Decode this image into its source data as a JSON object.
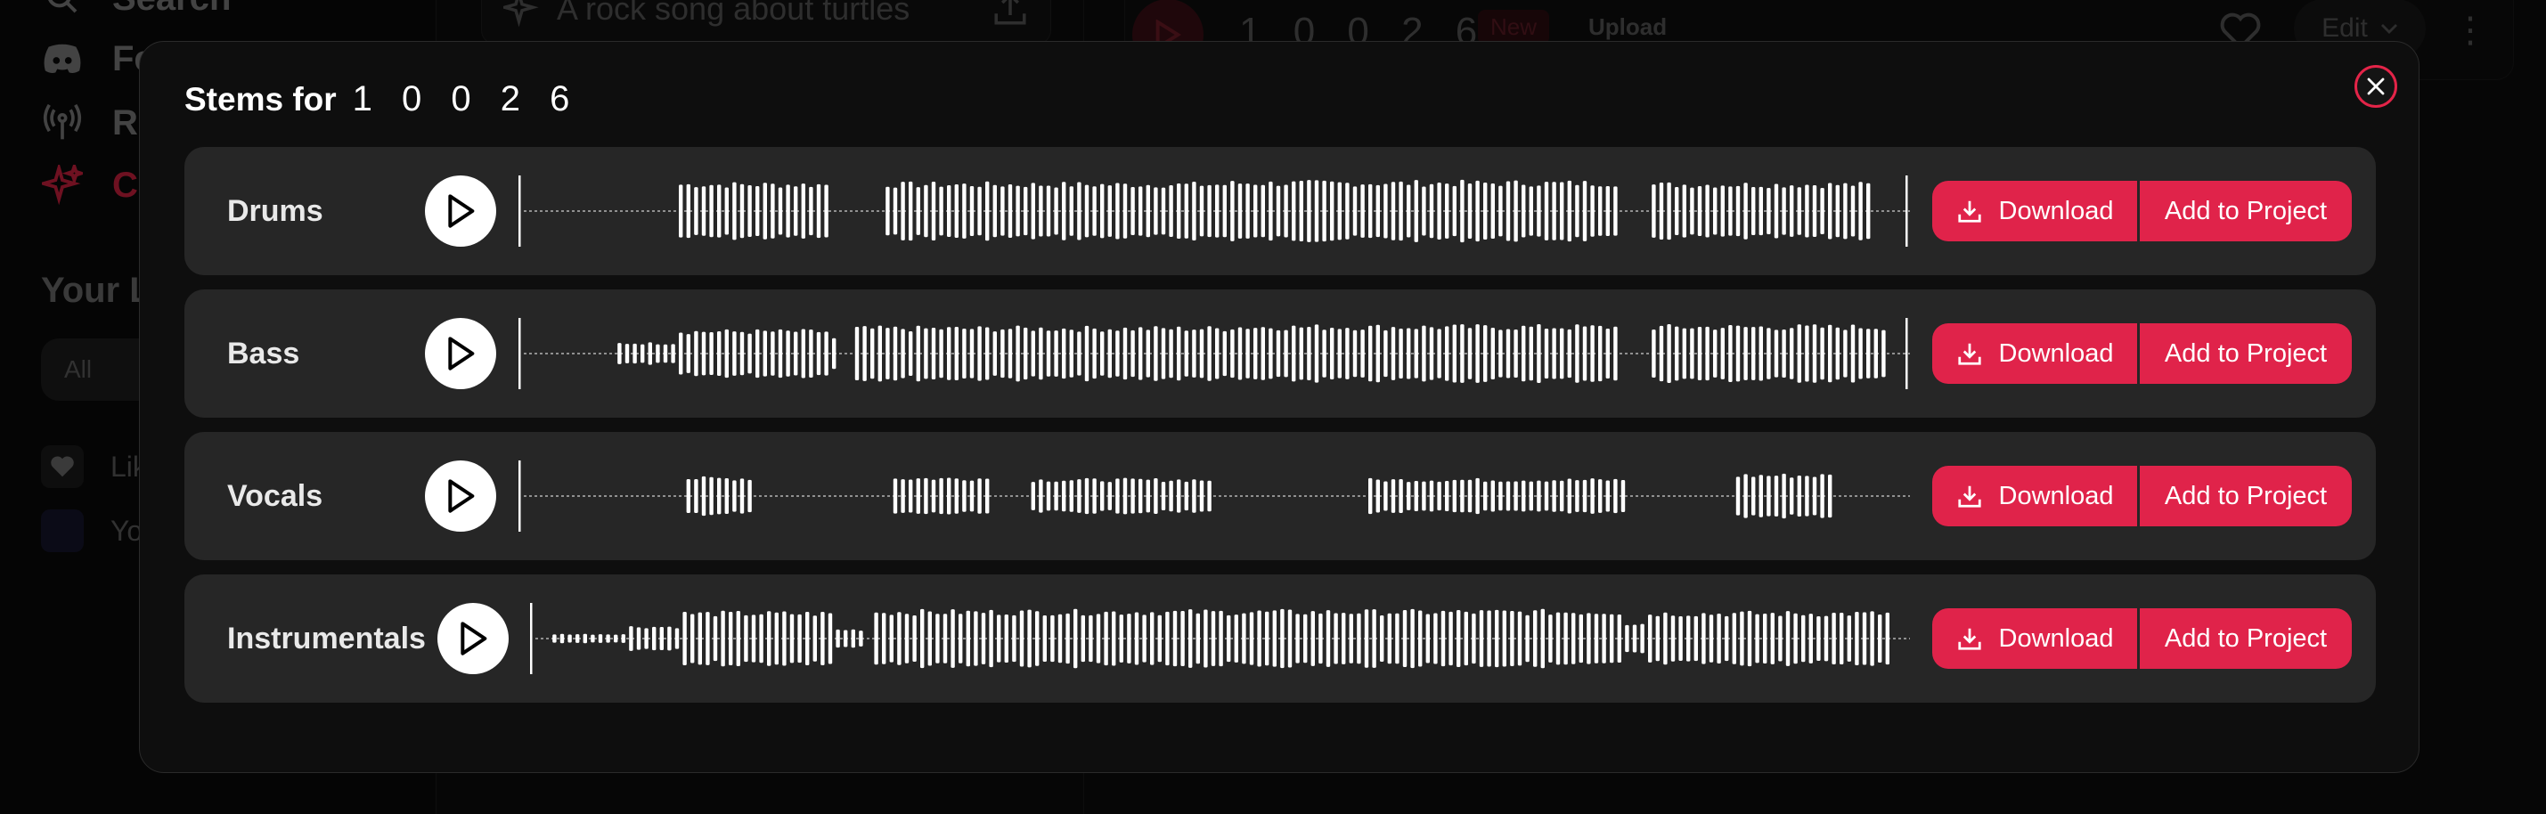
{
  "background": {
    "sidebar": {
      "nav_items": [
        {
          "label": "Search",
          "icon": "search-icon"
        },
        {
          "label": "Feedback",
          "icon": "discord-icon"
        },
        {
          "label": "Radio",
          "icon": "radio-icon"
        },
        {
          "label": "Create",
          "icon": "sparkle-icon"
        }
      ],
      "section_title": "Your Library",
      "filter": "All",
      "library_items": [
        {
          "label": "Liked Songs",
          "icon": "heart-icon"
        },
        {
          "label": "Your Uploads",
          "icon": "folder-icon"
        }
      ]
    },
    "prompt": {
      "text": "A rock song about turtles"
    },
    "song_header": {
      "title": "1 0 0 2 6",
      "badge": "New",
      "upload_label": "Upload",
      "edit_label": "Edit"
    }
  },
  "modal": {
    "title_prefix": "Stems for",
    "song_title": "1 0 0 2 6",
    "stems": [
      {
        "name": "Drums",
        "download_label": "Download",
        "add_label": "Add to Project"
      },
      {
        "name": "Bass",
        "download_label": "Download",
        "add_label": "Add to Project"
      },
      {
        "name": "Vocals",
        "download_label": "Download",
        "add_label": "Add to Project"
      },
      {
        "name": "Instrumentals",
        "download_label": "Download",
        "add_label": "Add to Project"
      }
    ]
  },
  "colors": {
    "accent": "#e0234a",
    "modal_bg": "#0e0e0e",
    "stem_row_bg": "#262626",
    "waveform": "#ffffff"
  }
}
